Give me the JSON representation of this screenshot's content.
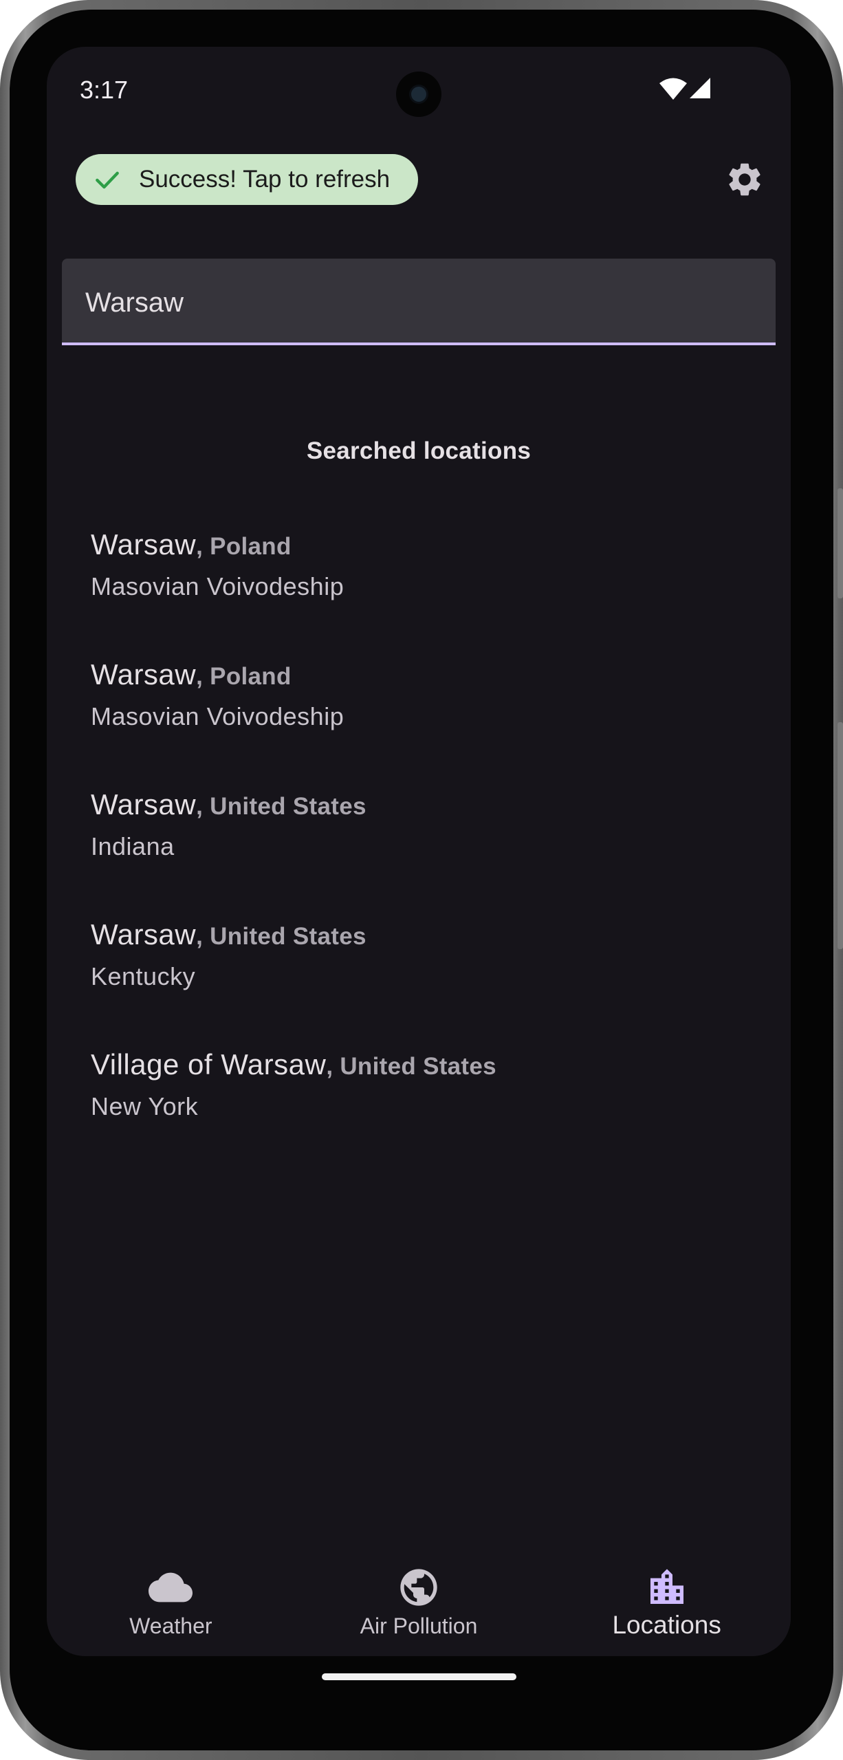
{
  "status_bar": {
    "time": "3:17"
  },
  "header": {
    "status_chip_label": "Success! Tap to refresh",
    "status_chip_color": "#cbe6c8",
    "check_icon_color": "#2e9e47"
  },
  "search": {
    "value": "Warsaw",
    "placeholder": "",
    "accent": "#cfbcff"
  },
  "results_section": {
    "title": "Searched locations",
    "items": [
      {
        "city": "Warsaw",
        "country": ", Poland",
        "region": "Masovian Voivodeship"
      },
      {
        "city": "Warsaw",
        "country": ", Poland",
        "region": "Masovian Voivodeship"
      },
      {
        "city": "Warsaw",
        "country": ", United States",
        "region": "Indiana"
      },
      {
        "city": "Warsaw",
        "country": ", United States",
        "region": "Kentucky"
      },
      {
        "city": "Village of Warsaw",
        "country": ", United States",
        "region": "New York"
      }
    ]
  },
  "bottom_nav": {
    "items": [
      {
        "label": "Weather",
        "icon": "cloud-icon",
        "active": false
      },
      {
        "label": "Air Pollution",
        "icon": "globe-icon",
        "active": false
      },
      {
        "label": "Locations",
        "icon": "city-icon",
        "active": true
      }
    ]
  },
  "theme": {
    "background": "#16141a",
    "surface_variant": "#36343b",
    "active_nav_icon": "#cfbcff"
  }
}
